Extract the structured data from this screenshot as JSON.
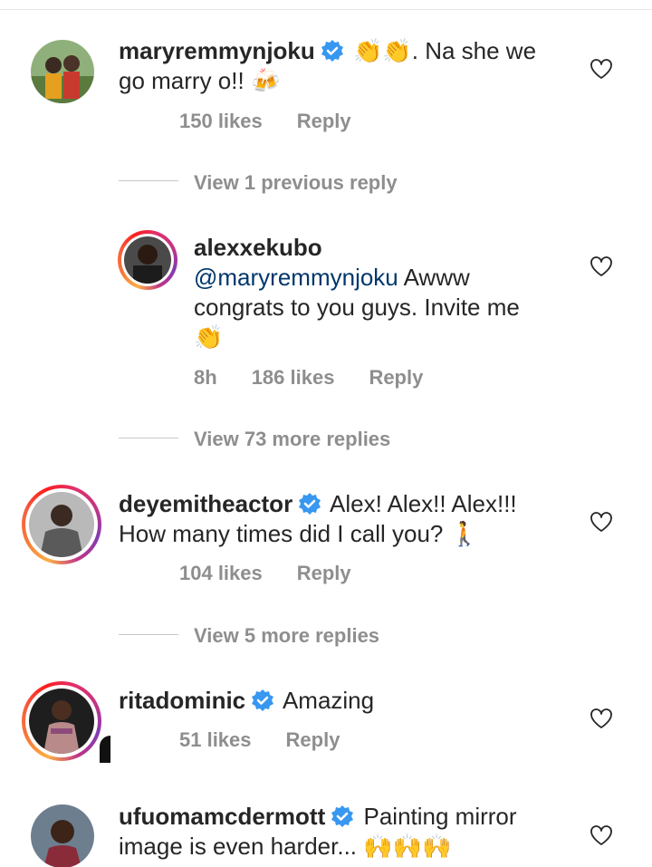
{
  "comments": [
    {
      "username": "maryremmynjoku",
      "verified": true,
      "line1_text": ". Na she we",
      "line2_text": "go marry o!!",
      "emojis_line1": [
        "clapping-hands",
        "clapping-hands"
      ],
      "emojis_line2": [
        "beer-mugs"
      ],
      "likes": "150 likes",
      "reply": "Reply",
      "avatar_story_ring": false
    },
    {
      "username": "deyemitheactor",
      "verified": true,
      "line1_text": "Alex! Alex!! Alex!!!",
      "line2_text": "How many times did I call you?",
      "emojis_line2": [
        "person-walking"
      ],
      "likes": "104 likes",
      "reply": "Reply",
      "avatar_story_ring": true
    },
    {
      "username": "ritadominic",
      "verified": true,
      "line1_text": "Amazing",
      "likes": "51 likes",
      "reply": "Reply",
      "avatar_story_ring": true
    },
    {
      "username": "ufuomamcdermott",
      "verified": true,
      "line1_text": "Painting mirror",
      "line2_text": "image is even harder...",
      "emojis_line2": [
        "raising-hands",
        "raising-hands",
        "raising-hands"
      ],
      "avatar_story_ring": false
    }
  ],
  "reply_thread": {
    "view_previous": "View 1 previous reply",
    "reply": {
      "username": "alexxekubo",
      "mention": "@maryremmynjoku",
      "line1_text": "Awww",
      "line2_text": "congrats to you guys. Invite me",
      "emojis_line3": [
        "clapping-hands-dark"
      ],
      "time": "8h",
      "likes": "186 likes",
      "reply_label": "Reply",
      "avatar_story_ring": true
    },
    "view_more": "View 73 more replies"
  },
  "second_thread": {
    "view_more": "View 5 more replies"
  },
  "colors": {
    "username": "#262626",
    "mention": "#00376b",
    "meta": "#8e8e8e",
    "verified": "#3897f0"
  },
  "icons": [
    "verified-badge-icon",
    "heart-outline-icon"
  ]
}
